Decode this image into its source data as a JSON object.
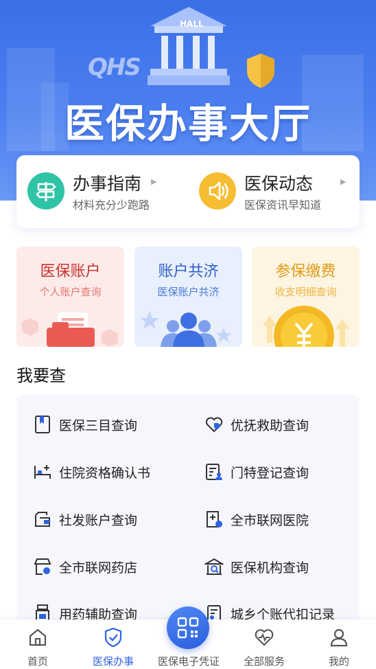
{
  "banner": {
    "title": "医保办事大厅",
    "hall_label": "HALL",
    "logo_text": "QHS"
  },
  "quick_links": [
    {
      "title": "办事指南",
      "subtitle": "材料充分少跑路",
      "icon": "signpost-icon",
      "color": "#2fc4a6"
    },
    {
      "title": "医保动态",
      "subtitle": "医保资讯早知道",
      "icon": "speaker-icon",
      "color": "#f6bd33"
    }
  ],
  "feature_cards": [
    {
      "title": "医保账户",
      "subtitle": "个人账户查询",
      "bg": "#fdebea",
      "title_color": "#c8332b",
      "sub_color": "#e6756c"
    },
    {
      "title": "账户共济",
      "subtitle": "医保账户共济",
      "bg": "#e8effd",
      "title_color": "#2f5fc8",
      "sub_color": "#4b79d8"
    },
    {
      "title": "参保缴费",
      "subtitle": "收支明细查询",
      "bg": "#fdf5e2",
      "title_color": "#e09a17",
      "sub_color": "#edb540"
    }
  ],
  "section": {
    "title": "我要查"
  },
  "query_items": [
    {
      "label": "医保三目查询",
      "icon": "bookmark-book-icon"
    },
    {
      "label": "优抚救助查询",
      "icon": "heart-hand-icon"
    },
    {
      "label": "住院资格确认书",
      "icon": "hospital-bed-icon"
    },
    {
      "label": "门特登记查询",
      "icon": "registration-card-icon"
    },
    {
      "label": "社发账户查询",
      "icon": "wallet-icon"
    },
    {
      "label": "全市联网医院",
      "icon": "hospital-building-icon"
    },
    {
      "label": "全市联网药店",
      "icon": "pharmacy-store-icon"
    },
    {
      "label": "医保机构查询",
      "icon": "institution-search-icon"
    },
    {
      "label": "用药辅助查询",
      "icon": "medicine-bottle-icon"
    },
    {
      "label": "城乡个账代扣记录",
      "icon": "deduction-record-icon"
    }
  ],
  "tabs": [
    {
      "label": "首页",
      "icon": "home-icon"
    },
    {
      "label": "医保办事",
      "icon": "shield-check-icon",
      "active": true
    },
    {
      "label": "医保电子凭证",
      "icon": "qr-code-icon"
    },
    {
      "label": "全部服务",
      "icon": "heart-pulse-icon"
    },
    {
      "label": "我的",
      "icon": "user-icon"
    }
  ],
  "colors": {
    "primary": "#2f63e0",
    "banner": "#3b6fe6"
  }
}
